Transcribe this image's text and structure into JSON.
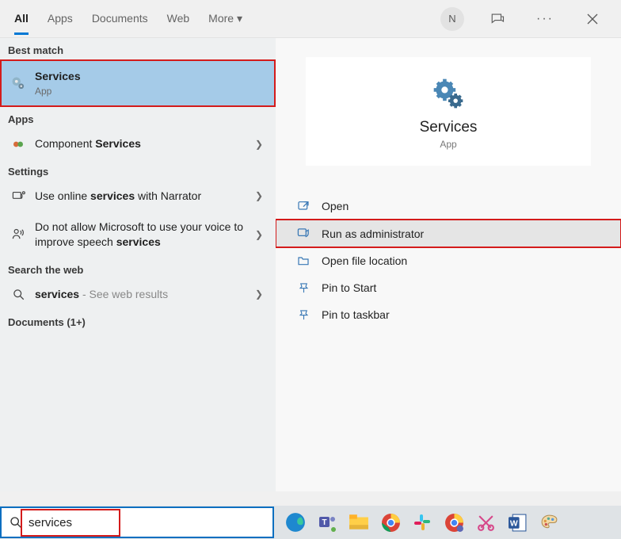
{
  "tabs": [
    {
      "label": "All",
      "active": true
    },
    {
      "label": "Apps"
    },
    {
      "label": "Documents"
    },
    {
      "label": "Web"
    },
    {
      "label": "More ▾"
    }
  ],
  "avatar_letter": "N",
  "sections": {
    "best_match": "Best match",
    "apps": "Apps",
    "settings": "Settings",
    "search_web": "Search the web",
    "documents": "Documents (1+)"
  },
  "best_item": {
    "title": "Services",
    "sub": "App"
  },
  "apps_item": {
    "prefix": "Component ",
    "bold": "Services"
  },
  "settings_items": [
    {
      "prefix": "Use online ",
      "bold": "services",
      "suffix": " with Narrator",
      "icon": "narrator"
    },
    {
      "prefix": "Do not allow Microsoft to use your voice to improve speech ",
      "bold": "services",
      "suffix": "",
      "icon": "voice"
    }
  ],
  "web_item": {
    "bold": "services",
    "suffix": " - See web results"
  },
  "preview": {
    "title": "Services",
    "sub": "App"
  },
  "actions": [
    {
      "label": "Open",
      "icon": "open"
    },
    {
      "label": "Run as administrator",
      "icon": "admin",
      "highlight": true
    },
    {
      "label": "Open file location",
      "icon": "folder"
    },
    {
      "label": "Pin to Start",
      "icon": "pin"
    },
    {
      "label": "Pin to taskbar",
      "icon": "pin"
    }
  ],
  "search_value": "services"
}
